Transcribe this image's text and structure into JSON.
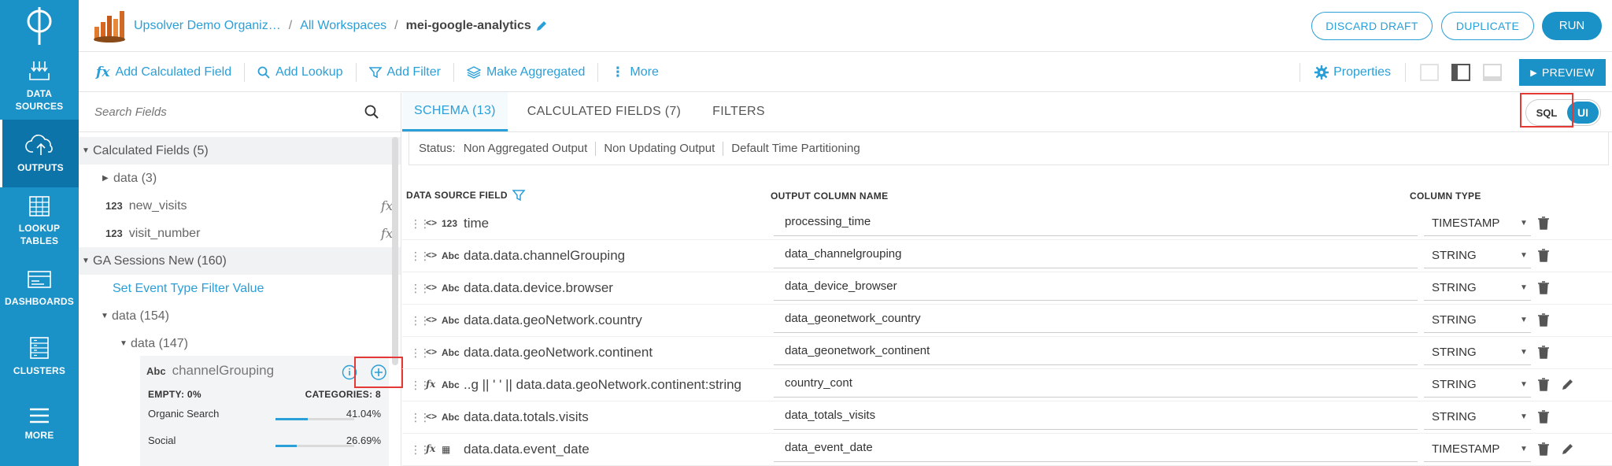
{
  "nav": {
    "items": [
      {
        "label1": "DATA",
        "label2": "SOURCES"
      },
      {
        "label1": "OUTPUTS",
        "label2": ""
      },
      {
        "label1": "LOOKUP",
        "label2": "TABLES"
      },
      {
        "label1": "DASHBOARDS",
        "label2": ""
      },
      {
        "label1": "CLUSTERS",
        "label2": ""
      },
      {
        "label1": "MORE",
        "label2": ""
      }
    ]
  },
  "header": {
    "org": "Upsolver Demo Organiz…",
    "sep": "/",
    "workspaces": "All Workspaces",
    "current": "mei-google-analytics",
    "discard": "DISCARD DRAFT",
    "duplicate": "DUPLICATE",
    "run": "RUN"
  },
  "toolbar": {
    "add_calc": "Add Calculated Field",
    "add_lookup": "Add Lookup",
    "add_filter": "Add Filter",
    "make_agg": "Make Aggregated",
    "more": "More",
    "properties": "Properties",
    "preview": "PREVIEW"
  },
  "left": {
    "search_placeholder": "Search Fields",
    "calc_group": "Calculated Fields (5)",
    "data3": "data (3)",
    "new_visits_type": "123",
    "new_visits": "new_visits",
    "visit_number_type": "123",
    "visit_number": "visit_number",
    "ga_group": "GA Sessions New (160)",
    "set_filter": "Set Event Type Filter Value",
    "data154": "data (154)",
    "data147": "data (147)",
    "card": {
      "type": "Abc",
      "name": "channelGrouping",
      "empty": "EMPTY: 0%",
      "categories": "CATEGORIES: 8",
      "rows": [
        {
          "label": "Organic Search",
          "pct": "41.04%",
          "value": 0.4104
        },
        {
          "label": "Social",
          "pct": "26.69%",
          "value": 0.2669
        }
      ]
    }
  },
  "main": {
    "tabs": [
      "SCHEMA (13)",
      "CALCULATED FIELDS (7)",
      "FILTERS"
    ],
    "toggle_sql": "SQL",
    "toggle_ui": "UI",
    "status_label": "Status:",
    "status": [
      "Non Aggregated Output",
      "Non Updating Output",
      "Default Time Partitioning"
    ],
    "col_source": "DATA SOURCE FIELD",
    "col_output": "OUTPUT COLUMN NAME",
    "col_type": "COLUMN TYPE",
    "rows": [
      {
        "type": "123",
        "src": "time",
        "out": "processing_time",
        "ctype": "TIMESTAMP",
        "fx": false,
        "edit": false
      },
      {
        "type": "Abc",
        "src": "data.data.channelGrouping",
        "out": "data_channelgrouping",
        "ctype": "STRING",
        "fx": false,
        "edit": false
      },
      {
        "type": "Abc",
        "src": "data.data.device.browser",
        "out": "data_device_browser",
        "ctype": "STRING",
        "fx": false,
        "edit": false
      },
      {
        "type": "Abc",
        "src": "data.data.geoNetwork.country",
        "out": "data_geonetwork_country",
        "ctype": "STRING",
        "fx": false,
        "edit": false
      },
      {
        "type": "Abc",
        "src": "data.data.geoNetwork.continent",
        "out": "data_geonetwork_continent",
        "ctype": "STRING",
        "fx": false,
        "edit": false
      },
      {
        "type": "Abc",
        "src": "..g || ' ' || data.data.geoNetwork.continent:string",
        "out": "country_cont",
        "ctype": "STRING",
        "fx": true,
        "edit": true
      },
      {
        "type": "Abc",
        "src": "data.data.totals.visits",
        "out": "data_totals_visits",
        "ctype": "STRING",
        "fx": false,
        "edit": false
      },
      {
        "type": "▦",
        "src": "data.data.event_date",
        "out": "data_event_date",
        "ctype": "TIMESTAMP",
        "fx": true,
        "edit": true
      }
    ]
  }
}
